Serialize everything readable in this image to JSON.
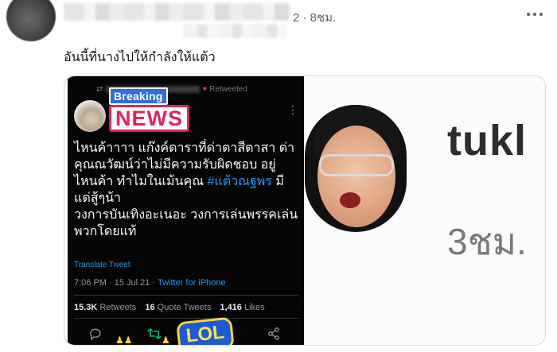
{
  "header": {
    "time": "2 · 8ชม.",
    "more_icon": "more-horizontal-icon"
  },
  "tweet": {
    "text": "อันนี้ที่นางไปให้กำลังให้แต้ว"
  },
  "embedded": {
    "retweeted_label": "Retweeted",
    "breaking_label": "Breaking",
    "news_label": "NEWS",
    "body_lines": [
      "ไหนค้าาาา แก๊งค์ดาราที่ด่าตาสีตาสา ด่า",
      "คุณณวัฒน์ว่าไม่มีความรับผิดชอบ อยู่",
      "ไหนค้า ทำไมในเม้นคุณ",
      "มี",
      "แต่สู้ๆน้า",
      "วงการบันเทิงอะเนอะ วงการเล่นพรรคเล่น",
      "พวกโดยแท้"
    ],
    "hashtag": "#แต้วณฐพร",
    "translate": "Translate Tweet",
    "timestamp": "7:06 PM · 15 Jul 21 · ",
    "source": "Twitter for iPhone",
    "stats": {
      "retweets_count": "15.3K",
      "retweets_label": "Retweets",
      "quotes_count": "16",
      "quotes_label": "Quote Tweets",
      "likes_count": "1,416",
      "likes_label": "Likes"
    },
    "sticker": "LOL"
  },
  "right_panel": {
    "name": "tukl",
    "time": "3ชม."
  },
  "colors": {
    "accent": "#1d9bf0",
    "breaking_bg": "#2f6edb",
    "news": "#e0245e"
  }
}
